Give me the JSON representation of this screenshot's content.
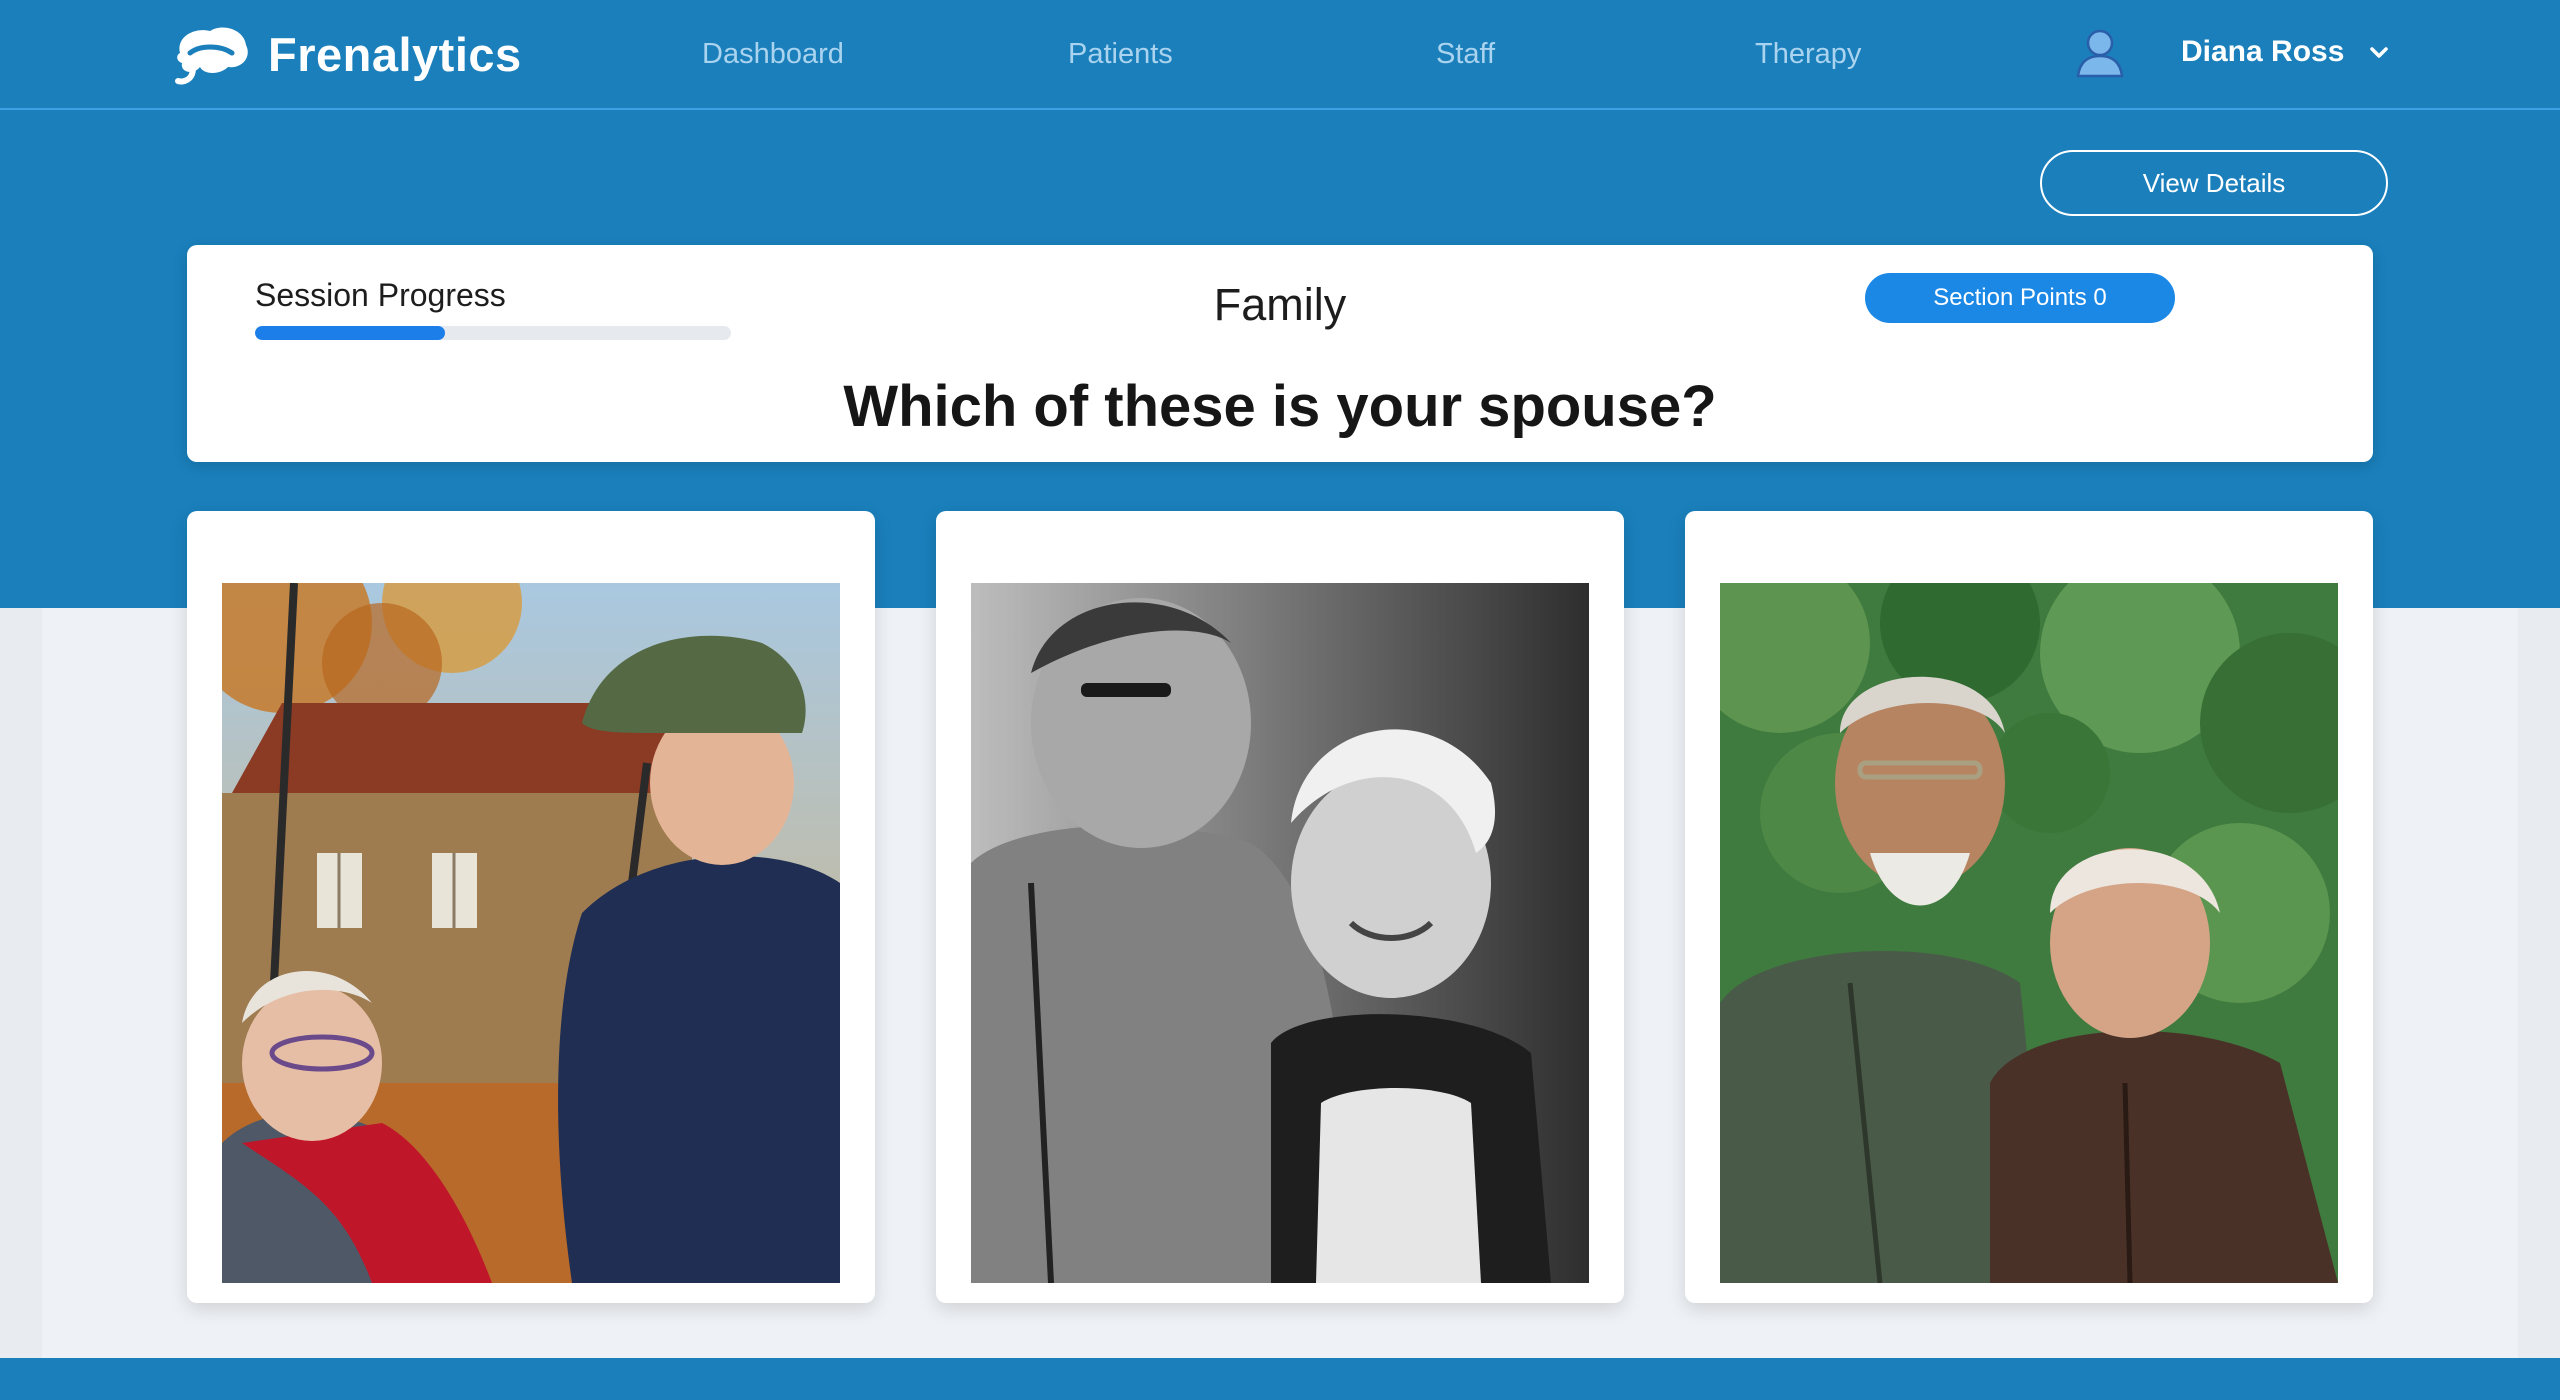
{
  "app": {
    "name": "Frenalytics"
  },
  "nav": {
    "links": [
      "Dashboard",
      "Patients",
      "Staff",
      "Therapy"
    ],
    "user": {
      "name": "Diana Ross"
    }
  },
  "actions": {
    "view_details": "View Details"
  },
  "session": {
    "progress_label": "Session Progress",
    "progress": 0.4,
    "section_title": "Family",
    "points_label": "Section Points 0",
    "question": "Which of these is your spouse?"
  },
  "options": [
    {
      "icon": "photo-elderly-couple-swing"
    },
    {
      "icon": "photo-elderly-couple-bw"
    },
    {
      "icon": "photo-elderly-couple-garden"
    }
  ],
  "colors": {
    "primary": "#1a7fbb",
    "accent": "#1c88e6",
    "background": "#eef1f5",
    "nav_link": "#a9d3ee"
  }
}
